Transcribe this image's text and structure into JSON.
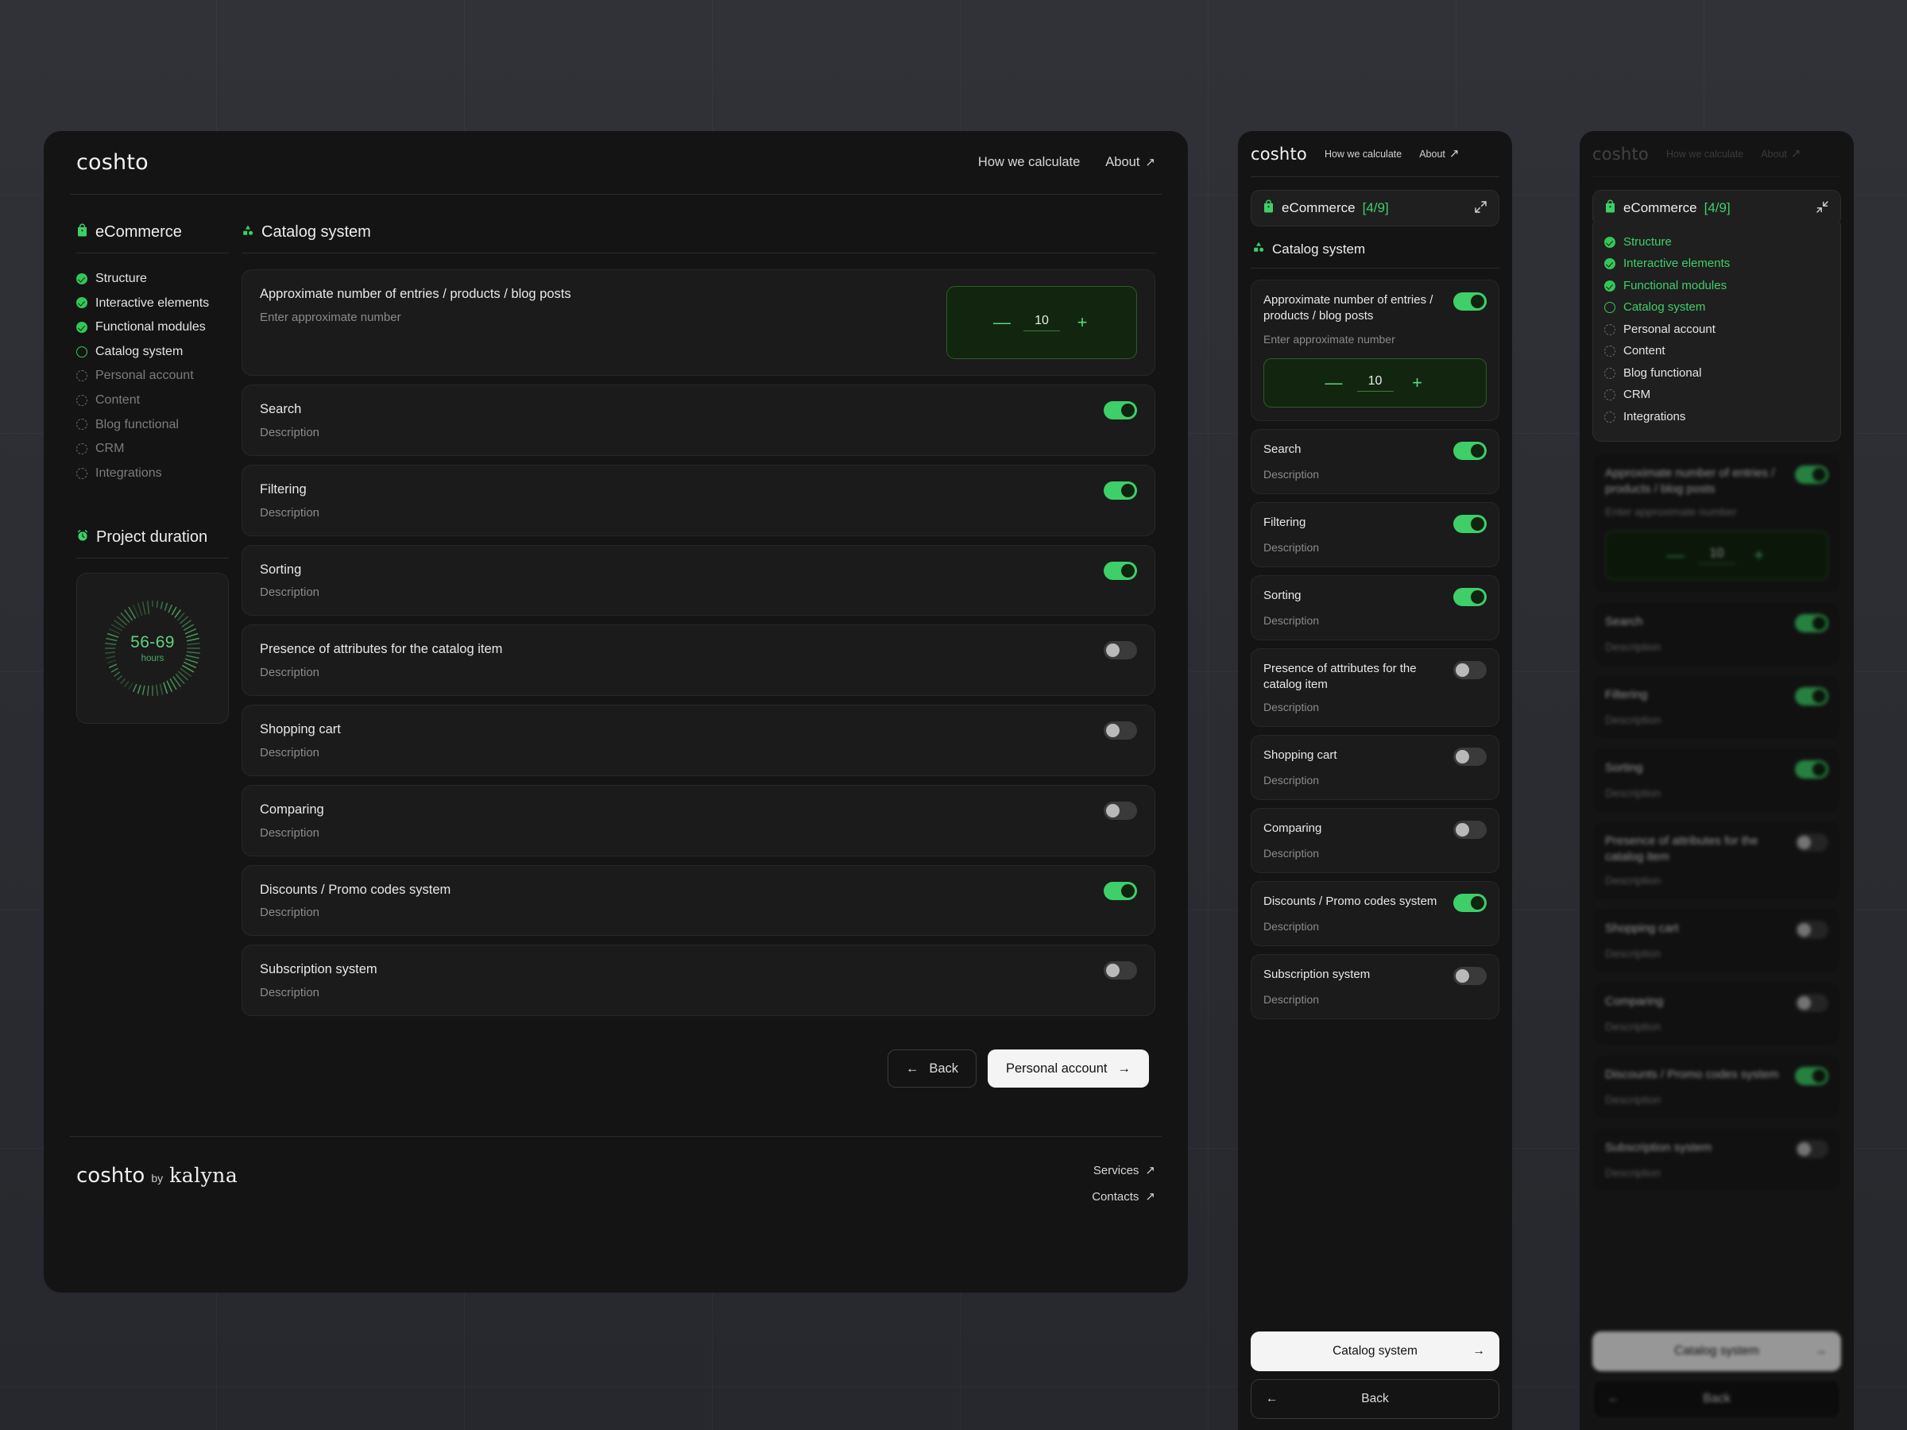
{
  "brand": {
    "logo": "coshto",
    "footer_logo_1": "coshto",
    "footer_by": "by",
    "footer_logo_2": "kalyna"
  },
  "nav": {
    "how_we_calculate": "How we calculate",
    "about": "About",
    "arrow": "↗"
  },
  "sidebar": {
    "title": "eCommerce",
    "icon": "shopping-bag-icon",
    "steps": [
      {
        "label": "Structure",
        "state": "done"
      },
      {
        "label": "Interactive elements",
        "state": "done"
      },
      {
        "label": "Functional modules",
        "state": "done"
      },
      {
        "label": "Catalog system",
        "state": "active"
      },
      {
        "label": "Personal account",
        "state": "todo"
      },
      {
        "label": "Content",
        "state": "todo"
      },
      {
        "label": "Blog functional",
        "state": "todo"
      },
      {
        "label": "CRM",
        "state": "todo"
      },
      {
        "label": "Integrations",
        "state": "todo"
      }
    ]
  },
  "duration": {
    "title": "Project duration",
    "icon": "alarm-clock-icon",
    "value": "56-69",
    "unit": "hours"
  },
  "main": {
    "section_title": "Catalog system",
    "section_icon": "catalog-shapes-icon",
    "stepper": {
      "value": "10",
      "minus": "—",
      "plus": "+"
    },
    "rows": [
      {
        "title": "Approximate number of entries / products / blog posts",
        "desc": "Enter approximate number",
        "control": "stepper",
        "toggle": "on"
      },
      {
        "title": "Search",
        "desc": "Description",
        "control": "toggle",
        "toggle": "on"
      },
      {
        "title": "Filtering",
        "desc": "Description",
        "control": "toggle",
        "toggle": "on"
      },
      {
        "title": "Sorting",
        "desc": "Description",
        "control": "toggle",
        "toggle": "on"
      },
      {
        "title": "Presence of attributes for the catalog item",
        "desc": "Description",
        "control": "toggle",
        "toggle": "off"
      },
      {
        "title": "Shopping cart",
        "desc": "Description",
        "control": "toggle",
        "toggle": "off"
      },
      {
        "title": "Comparing",
        "desc": "Description",
        "control": "toggle",
        "toggle": "off"
      },
      {
        "title": "Discounts / Promo codes system",
        "desc": "Description",
        "control": "toggle",
        "toggle": "on"
      },
      {
        "title": "Subscription system",
        "desc": "Description",
        "control": "toggle",
        "toggle": "off"
      }
    ]
  },
  "desktop_actions": {
    "back": "Back",
    "back_arrow": "←",
    "next": "Personal account",
    "next_arrow": "→"
  },
  "footer": {
    "services": "Services",
    "contacts": "Contacts",
    "arrow": "↗"
  },
  "mobile": {
    "accordion_label": "eCommerce",
    "accordion_count": "[4/9]",
    "expand_icon": "expand-arrows-icon",
    "collapse_icon": "collapse-arrows-icon",
    "primary_btn": "Catalog system",
    "primary_arrow": "→",
    "back_btn": "Back",
    "back_arrow": "←",
    "rows": [
      {
        "title": "Approximate number of entries / products / blog posts",
        "desc": "Enter approximate number",
        "control": "stepper",
        "toggle": "on"
      },
      {
        "title": "Search",
        "desc": "Description",
        "control": "toggle",
        "toggle": "on"
      },
      {
        "title": "Filtering",
        "desc": "Description",
        "control": "toggle",
        "toggle": "on"
      },
      {
        "title": "Sorting",
        "desc": "Description",
        "control": "toggle",
        "toggle": "on"
      },
      {
        "title": "Presence of attributes for the catalog item",
        "desc": "Description",
        "control": "toggle",
        "toggle": "off"
      },
      {
        "title": "Shopping cart",
        "desc": "Description",
        "control": "toggle",
        "toggle": "off"
      },
      {
        "title": "Comparing",
        "desc": "Description",
        "control": "toggle",
        "toggle": "off"
      },
      {
        "title": "Discounts / Promo codes system",
        "desc": "Description",
        "control": "toggle",
        "toggle": "on"
      },
      {
        "title": "Subscription system",
        "desc": "Description",
        "control": "toggle",
        "toggle": "off"
      }
    ]
  },
  "colors": {
    "accent": "#3ecf68",
    "accent_text": "#5fd47c",
    "panel": "#141414",
    "card": "#1b1b1b",
    "stepper_bg": "#12260f"
  }
}
